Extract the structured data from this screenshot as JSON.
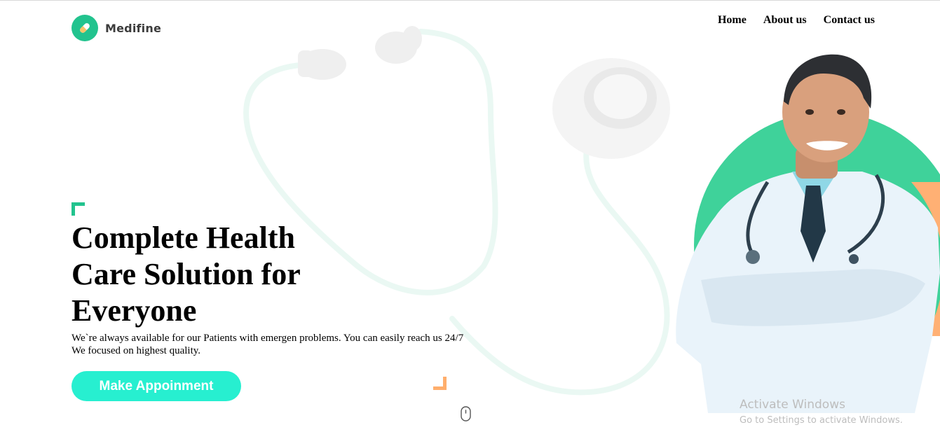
{
  "brand": {
    "name": "Medifine",
    "icon": "pill-icon",
    "color": "#22c38e"
  },
  "nav": {
    "items": [
      {
        "label": "Home"
      },
      {
        "label": "About us"
      },
      {
        "label": "Contact us"
      }
    ]
  },
  "hero": {
    "title": "Complete Health Care Solution for Everyone",
    "description": "We`re always available for our Patients with emergen problems. You can easily reach us 24/7 We focused on highest quality.",
    "cta_label": "Make Appoinment",
    "cta_color": "#27efd0",
    "accent_green": "#22c38e",
    "accent_orange": "#ffae6c"
  },
  "illustration": {
    "background": "stethoscope-illustration",
    "doctor": "doctor-photo",
    "scroll_hint": "mouse-scroll-icon"
  },
  "os_watermark": {
    "line1": "Activate Windows",
    "line2": "Go to Settings to activate Windows."
  }
}
